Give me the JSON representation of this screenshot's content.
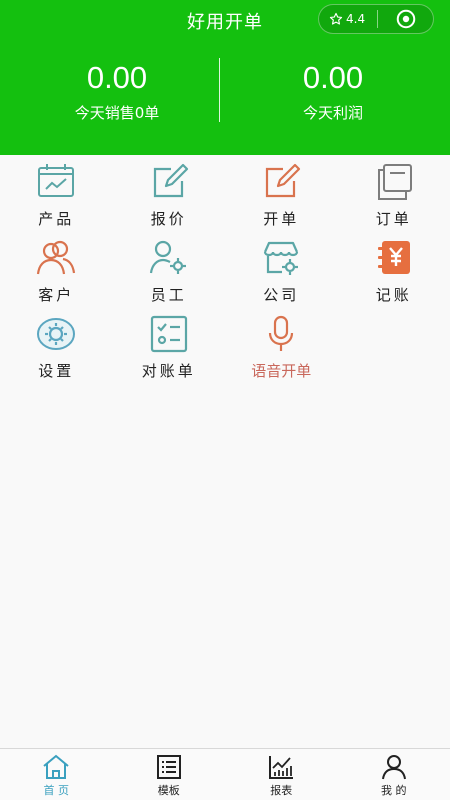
{
  "header": {
    "title": "好用开单",
    "rating": "4.4",
    "background": "#14c00f"
  },
  "stats": [
    {
      "value": "0.00",
      "label": "今天销售0单"
    },
    {
      "value": "0.00",
      "label": "今天利润"
    }
  ],
  "menu": [
    {
      "label": "产品",
      "icon": "product-chart-icon"
    },
    {
      "label": "报价",
      "icon": "quote-edit-icon"
    },
    {
      "label": "开单",
      "icon": "create-order-icon"
    },
    {
      "label": "订单",
      "icon": "orders-icon"
    },
    {
      "label": "客户",
      "icon": "customers-icon"
    },
    {
      "label": "员工",
      "icon": "staff-icon"
    },
    {
      "label": "公司",
      "icon": "company-store-icon"
    },
    {
      "label": "记账",
      "icon": "bookkeeping-yen-icon"
    },
    {
      "label": "设置",
      "icon": "settings-gear-icon"
    },
    {
      "label": "对账单",
      "icon": "statement-checklist-icon"
    },
    {
      "label": "语音开单",
      "icon": "microphone-icon"
    }
  ],
  "tabs": [
    {
      "label": "首 页",
      "icon": "home-icon",
      "active": true
    },
    {
      "label": "模板",
      "icon": "template-list-icon",
      "active": false
    },
    {
      "label": "报表",
      "icon": "report-chart-icon",
      "active": false
    },
    {
      "label": "我 的",
      "icon": "user-profile-icon",
      "active": false
    }
  ],
  "colors": {
    "brand_green": "#14c00f",
    "teal": "#5ba6a6",
    "orange": "#d9734e",
    "gray": "#7d7d7d",
    "active_tab": "#3aa0bf",
    "voice_label": "#c9685c"
  }
}
